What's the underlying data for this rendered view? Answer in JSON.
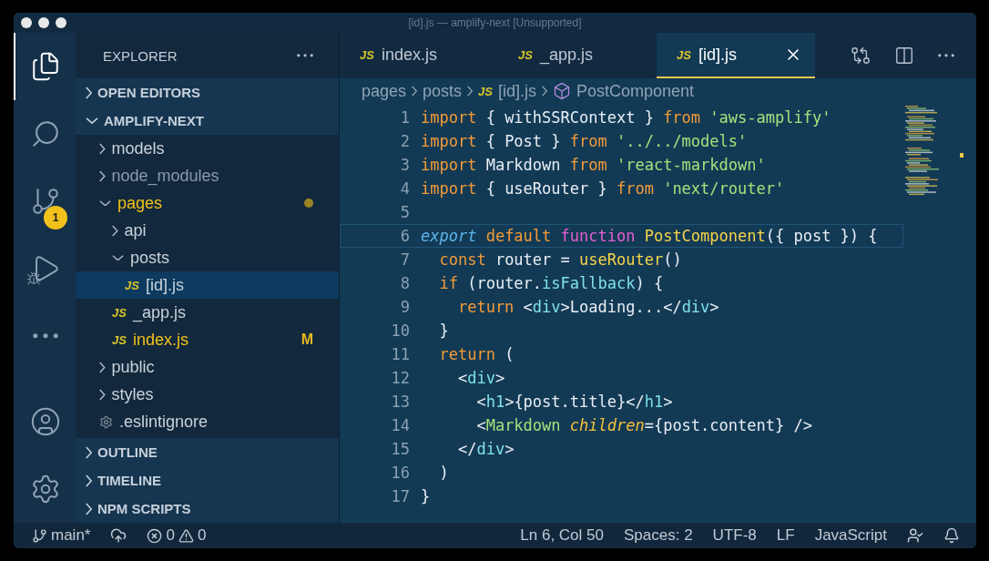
{
  "window": {
    "title": "[id].js — amplify-next [Unsupported]"
  },
  "activity_bar": [
    {
      "kind": "files",
      "selected": true
    },
    {
      "kind": "search",
      "selected": false
    },
    {
      "kind": "source-control",
      "selected": false,
      "badge": "1"
    },
    {
      "kind": "run",
      "selected": false
    },
    {
      "kind": "more",
      "selected": false
    },
    {
      "kind": "account",
      "selected": false
    },
    {
      "kind": "settings",
      "selected": false
    }
  ],
  "sidebar": {
    "title": "EXPLORER",
    "sections": [
      {
        "label": "OPEN EDITORS",
        "expanded": false
      },
      {
        "label": "AMPLIFY-NEXT",
        "expanded": true,
        "items": [
          {
            "name": "models",
            "kind": "folder",
            "expanded": false,
            "selected": false,
            "modified": false
          },
          {
            "name": "node_modules",
            "kind": "folder",
            "expanded": false,
            "selected": false,
            "modified": false,
            "dimmed": true
          },
          {
            "name": "pages",
            "kind": "folder",
            "expanded": true,
            "selected": false,
            "modified": true,
            "children": [
              {
                "name": "api",
                "kind": "folder",
                "expanded": false,
                "selected": false,
                "modified": false
              },
              {
                "name": "posts",
                "kind": "folder",
                "expanded": true,
                "selected": false,
                "modified": false,
                "children": [
                  {
                    "name": "[id].js",
                    "kind": "file",
                    "icon": "JS",
                    "selected": true,
                    "modified": false
                  }
                ]
              },
              {
                "name": "_app.js",
                "kind": "file",
                "icon": "JS",
                "selected": false,
                "modified": false
              },
              {
                "name": "index.js",
                "kind": "file",
                "icon": "JS",
                "selected": false,
                "modified": true,
                "badge": "M"
              }
            ]
          },
          {
            "name": "public",
            "kind": "folder",
            "expanded": false,
            "selected": false,
            "modified": false
          },
          {
            "name": "styles",
            "kind": "folder",
            "expanded": false,
            "selected": false,
            "modified": false
          },
          {
            "name": ".eslintignore",
            "kind": "config",
            "selected": false,
            "modified": false
          }
        ]
      },
      {
        "label": "OUTLINE",
        "expanded": false
      },
      {
        "label": "TIMELINE",
        "expanded": false
      },
      {
        "label": "NPM SCRIPTS",
        "expanded": false
      }
    ]
  },
  "tabs": [
    {
      "icon": "JS",
      "label": "index.js",
      "selected": false
    },
    {
      "icon": "JS",
      "label": "_app.js",
      "selected": false
    },
    {
      "icon": "JS",
      "label": "[id].js",
      "selected": true
    }
  ],
  "breadcrumb": [
    {
      "label": "pages",
      "kind": "folder"
    },
    {
      "label": "posts",
      "kind": "folder"
    },
    {
      "label": "[id].js",
      "kind": "file",
      "icon": "JS"
    },
    {
      "label": "PostComponent",
      "kind": "symbol"
    }
  ],
  "code": [
    {
      "number": "1",
      "current": false,
      "tokens": [
        {
          "kind": "keyword",
          "text": "import"
        },
        {
          "kind": "plain",
          "text": " { withSSRContext } "
        },
        {
          "kind": "keyword",
          "text": "from"
        },
        {
          "kind": "string",
          "text": " 'aws-amplify'"
        }
      ]
    },
    {
      "number": "2",
      "current": false,
      "tokens": [
        {
          "kind": "keyword",
          "text": "import"
        },
        {
          "kind": "plain",
          "text": " { Post } "
        },
        {
          "kind": "keyword",
          "text": "from"
        },
        {
          "kind": "string",
          "text": " '../../models'"
        }
      ]
    },
    {
      "number": "3",
      "current": false,
      "tokens": [
        {
          "kind": "keyword",
          "text": "import"
        },
        {
          "kind": "plain",
          "text": " Markdown "
        },
        {
          "kind": "keyword",
          "text": "from"
        },
        {
          "kind": "string",
          "text": " 'react-markdown'"
        }
      ]
    },
    {
      "number": "4",
      "current": false,
      "tokens": [
        {
          "kind": "keyword",
          "text": "import"
        },
        {
          "kind": "plain",
          "text": " { useRouter } "
        },
        {
          "kind": "keyword",
          "text": "from"
        },
        {
          "kind": "string",
          "text": " 'next/router'"
        }
      ]
    },
    {
      "number": "5",
      "current": false
    },
    {
      "number": "6",
      "current": true,
      "tokens": [
        {
          "kind": "storage",
          "text": "export"
        },
        {
          "kind": "keyword",
          "text": " default"
        },
        {
          "kind": "func",
          "text": " function"
        },
        {
          "kind": "name",
          "text": " PostComponent"
        },
        {
          "kind": "plain",
          "text": "({ post }) {"
        }
      ]
    },
    {
      "number": "7",
      "current": false,
      "tokens": [
        {
          "kind": "keyword",
          "text": "  const"
        },
        {
          "kind": "plain",
          "text": " router = "
        },
        {
          "kind": "name",
          "text": "useRouter"
        },
        {
          "kind": "plain",
          "text": "()"
        }
      ]
    },
    {
      "number": "8",
      "current": false,
      "tokens": [
        {
          "kind": "keyword",
          "text": "  if"
        },
        {
          "kind": "plain",
          "text": " (router."
        },
        {
          "kind": "prop",
          "text": "isFallback"
        },
        {
          "kind": "plain",
          "text": ") {"
        }
      ]
    },
    {
      "number": "9",
      "current": false,
      "tokens": [
        {
          "kind": "keyword",
          "text": "    return"
        },
        {
          "kind": "plain",
          "text": " <"
        },
        {
          "kind": "tag",
          "text": "div"
        },
        {
          "kind": "plain",
          "text": ">Loading...</"
        },
        {
          "kind": "tag",
          "text": "div"
        },
        {
          "kind": "plain",
          "text": ">"
        }
      ]
    },
    {
      "number": "10",
      "current": false,
      "tokens": [
        {
          "kind": "plain",
          "text": "  }"
        }
      ]
    },
    {
      "number": "11",
      "current": false,
      "tokens": [
        {
          "kind": "keyword",
          "text": "  return"
        },
        {
          "kind": "plain",
          "text": " ("
        }
      ]
    },
    {
      "number": "12",
      "current": false,
      "tokens": [
        {
          "kind": "plain",
          "text": "    <"
        },
        {
          "kind": "tag",
          "text": "div"
        },
        {
          "kind": "plain",
          "text": ">"
        }
      ]
    },
    {
      "number": "13",
      "current": false,
      "tokens": [
        {
          "kind": "plain",
          "text": "      <"
        },
        {
          "kind": "tag",
          "text": "h1"
        },
        {
          "kind": "plain",
          "text": ">{post.title}</"
        },
        {
          "kind": "tag",
          "text": "h1"
        },
        {
          "kind": "plain",
          "text": ">"
        }
      ]
    },
    {
      "number": "14",
      "current": false,
      "tokens": [
        {
          "kind": "plain",
          "text": "      <"
        },
        {
          "kind": "component",
          "text": "Markdown"
        },
        {
          "kind": "attr",
          "text": " children"
        },
        {
          "kind": "plain",
          "text": "={post.content} />"
        }
      ]
    },
    {
      "number": "15",
      "current": false,
      "tokens": [
        {
          "kind": "plain",
          "text": "    </"
        },
        {
          "kind": "tag",
          "text": "div"
        },
        {
          "kind": "plain",
          "text": ">"
        }
      ]
    },
    {
      "number": "16",
      "current": false,
      "tokens": [
        {
          "kind": "plain",
          "text": "  )"
        }
      ]
    },
    {
      "number": "17",
      "current": false,
      "tokens": [
        {
          "kind": "plain",
          "text": "}"
        }
      ]
    }
  ],
  "status_bar": {
    "branch": "main*",
    "errors": "0",
    "warnings": "0",
    "items": [
      "Ln 6, Col 50",
      "Spaces: 2",
      "UTF-8",
      "LF",
      "JavaScript"
    ]
  }
}
